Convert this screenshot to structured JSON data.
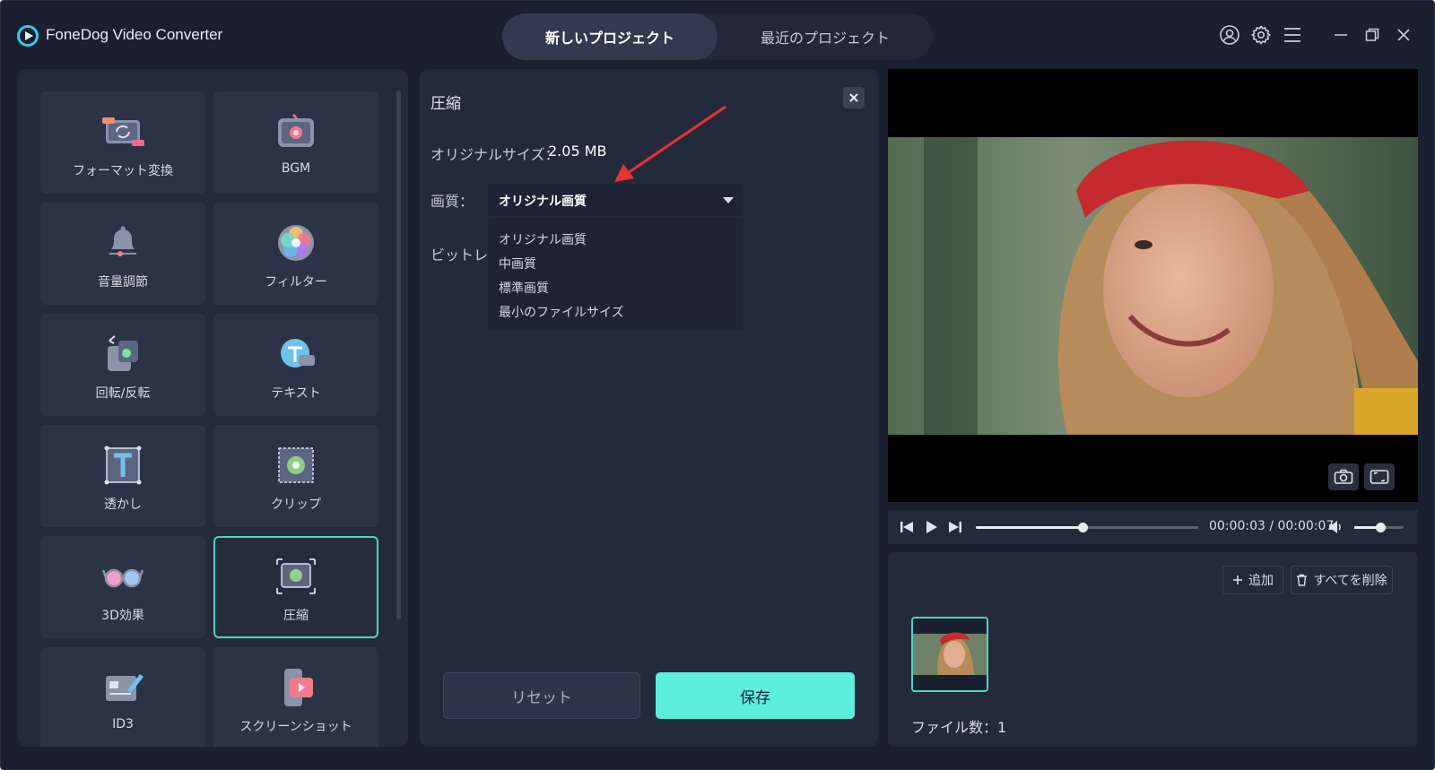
{
  "app": {
    "title": "FoneDog Video Converter"
  },
  "tabs": [
    {
      "label": "新しいプロジェクト",
      "active": true
    },
    {
      "label": "最近のプロジェクト",
      "active": false
    }
  ],
  "window_controls": [
    "user-icon",
    "settings-icon",
    "menu-icon",
    "minimize-icon",
    "restore-icon",
    "close-icon"
  ],
  "tools": [
    {
      "label": "フォーマット変換",
      "icon": "format-convert-icon",
      "selected": false
    },
    {
      "label": "BGM",
      "icon": "music-icon",
      "selected": false
    },
    {
      "label": "音量調節",
      "icon": "volume-bell-icon",
      "selected": false
    },
    {
      "label": "フィルター",
      "icon": "filter-icon",
      "selected": false
    },
    {
      "label": "回転/反転",
      "icon": "rotate-icon",
      "selected": false
    },
    {
      "label": "テキスト",
      "icon": "text-icon",
      "selected": false
    },
    {
      "label": "透かし",
      "icon": "watermark-icon",
      "selected": false
    },
    {
      "label": "クリップ",
      "icon": "crop-icon",
      "selected": false
    },
    {
      "label": "3D効果",
      "icon": "3d-glasses-icon",
      "selected": false
    },
    {
      "label": "圧縮",
      "icon": "compress-icon",
      "selected": true
    },
    {
      "label": "ID3",
      "icon": "id3-icon",
      "selected": false
    },
    {
      "label": "スクリーンショット",
      "icon": "screenshot-icon",
      "selected": false
    }
  ],
  "compress": {
    "title": "圧縮",
    "original_size_label": "オリジナルサイズ：",
    "original_size_value": "2.05 MB",
    "quality_label": "画質：",
    "quality_selected": "オリジナル画質",
    "bitrate_label": "ビットレート",
    "quality_options": [
      "オリジナル画質",
      "中画質",
      "標準画質",
      "最小のファイルサイズ"
    ],
    "reset_label": "リセット",
    "save_label": "保存"
  },
  "player": {
    "time": "00:00:03 / 00:00:07",
    "progress_fraction": 0.48,
    "volume_fraction": 0.52
  },
  "files": {
    "add_label": "追加",
    "delete_all_label": "すべてを削除",
    "count_label": "ファイル数：",
    "count_value": "1"
  },
  "colors": {
    "accent": "#5eeedd",
    "background": "#1b2030",
    "panel": "#232a3b",
    "tile": "#2c3346"
  }
}
